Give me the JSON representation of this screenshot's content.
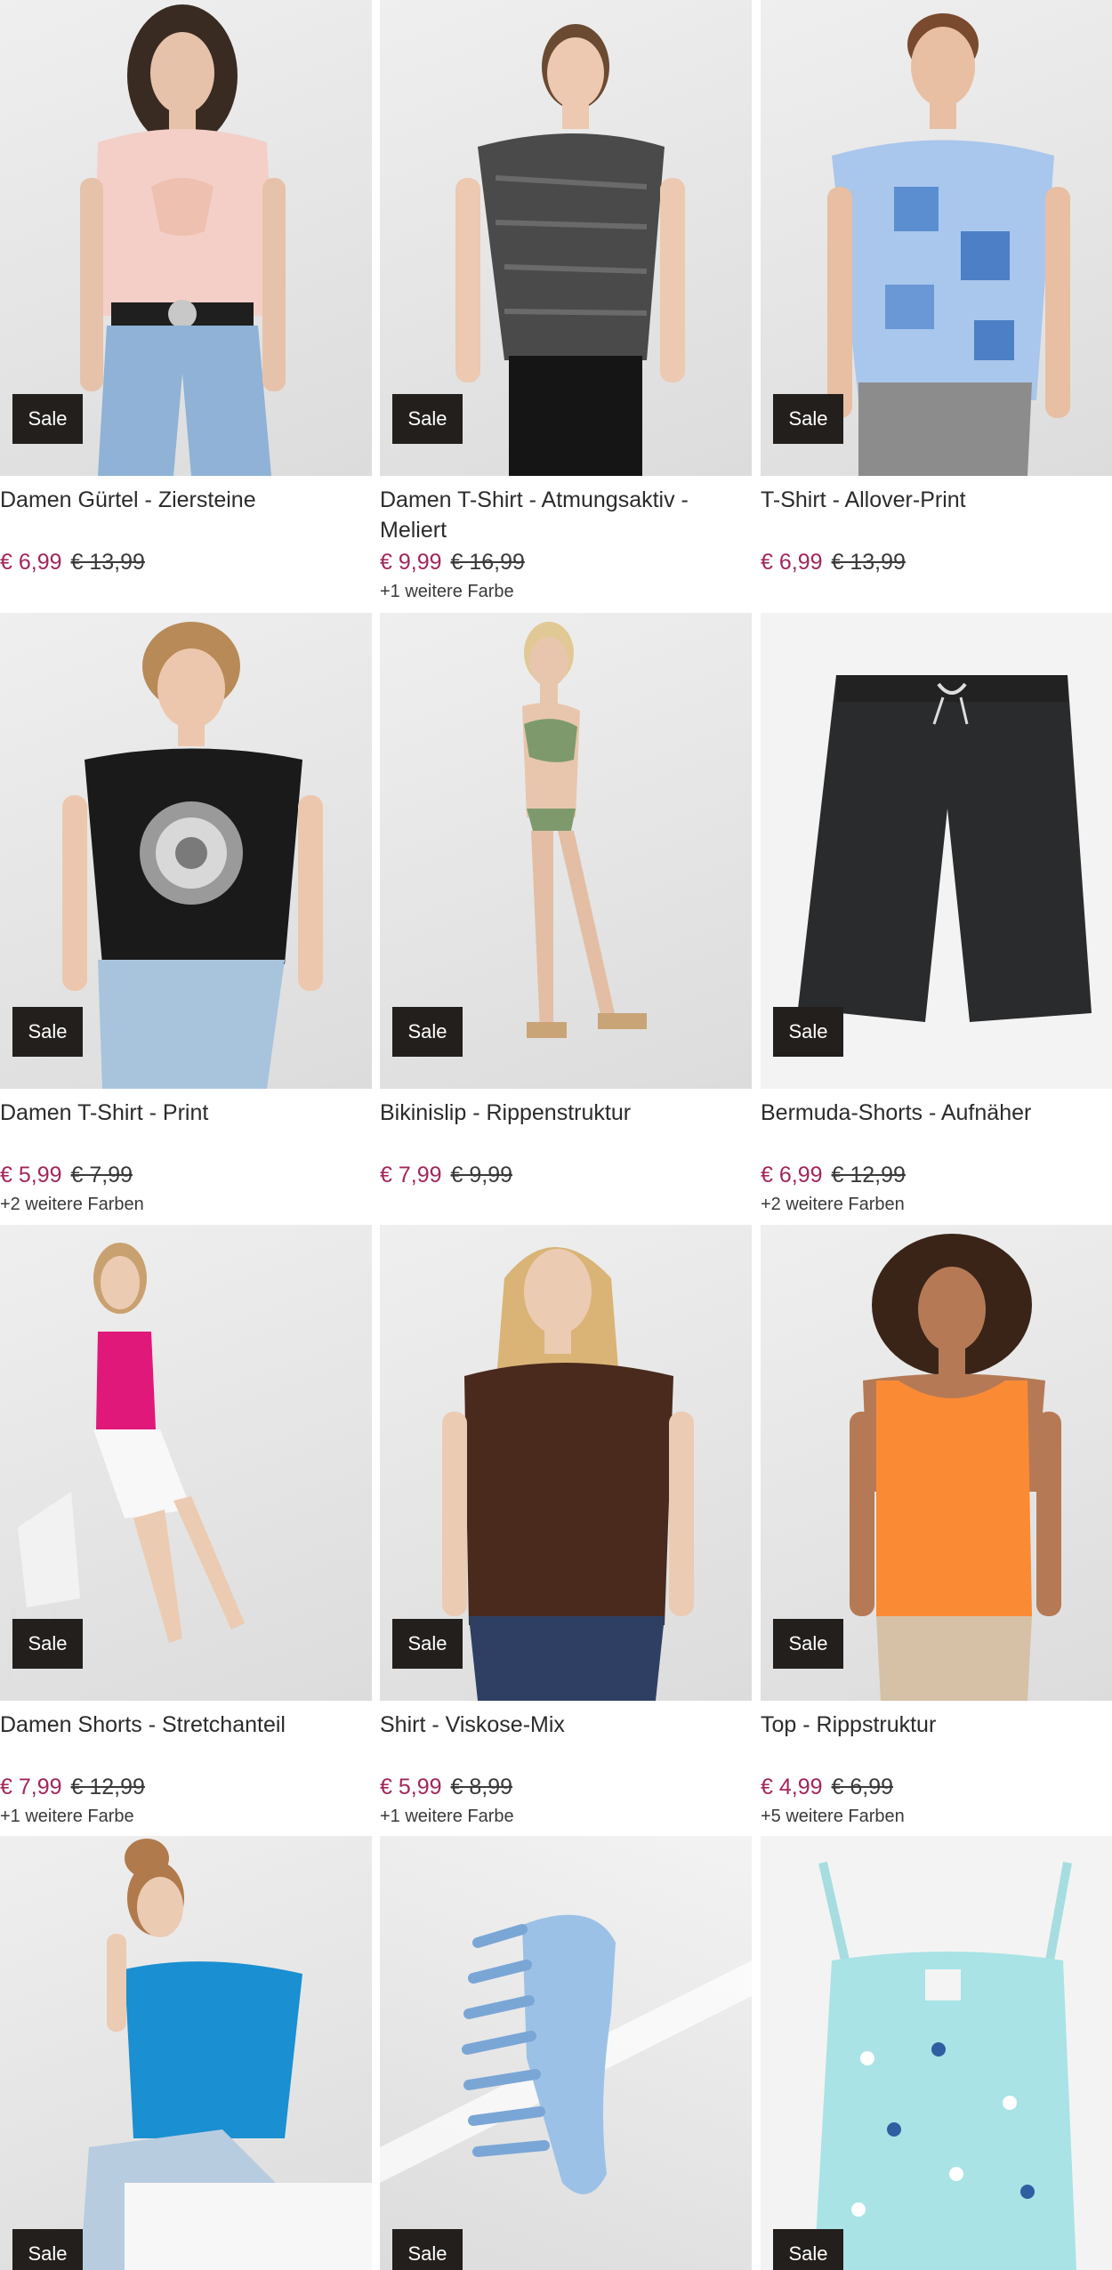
{
  "sale_badge": "Sale",
  "colors": {
    "sale_price": "#a3265b",
    "badge_bg": "#231f1c"
  },
  "products": [
    {
      "title": "Damen Gürtel - Ziersteine",
      "price": "€ 6,99",
      "old_price": "€ 13,99",
      "more_colors": ""
    },
    {
      "title": "Damen T-Shirt - Atmungsaktiv - Meliert",
      "price": "€ 9,99",
      "old_price": "€ 16,99",
      "more_colors": "+1 weitere Farbe"
    },
    {
      "title": "T-Shirt - Allover-Print",
      "price": "€ 6,99",
      "old_price": "€ 13,99",
      "more_colors": ""
    },
    {
      "title": "Damen T-Shirt - Print",
      "price": "€ 5,99",
      "old_price": "€ 7,99",
      "more_colors": "+2 weitere Farben"
    },
    {
      "title": "Bikinislip - Rippenstruktur",
      "price": "€ 7,99",
      "old_price": "€ 9,99",
      "more_colors": ""
    },
    {
      "title": "Bermuda-Shorts - Aufnäher",
      "price": "€ 6,99",
      "old_price": "€ 12,99",
      "more_colors": "+2 weitere Farben"
    },
    {
      "title": "Damen Shorts - Stretchanteil",
      "price": "€ 7,99",
      "old_price": "€ 12,99",
      "more_colors": "+1 weitere Farbe"
    },
    {
      "title": "Shirt - Viskose-Mix",
      "price": "€ 5,99",
      "old_price": "€ 8,99",
      "more_colors": "+1 weitere Farbe"
    },
    {
      "title": "Top - Rippstruktur",
      "price": "€ 4,99",
      "old_price": "€ 6,99",
      "more_colors": "+5 weitere Farben"
    },
    {
      "image": "blue-tshirt-model-photo"
    },
    {
      "image": "blue-hair-clip-photo"
    },
    {
      "image": "mint-floral-top-photo"
    }
  ]
}
